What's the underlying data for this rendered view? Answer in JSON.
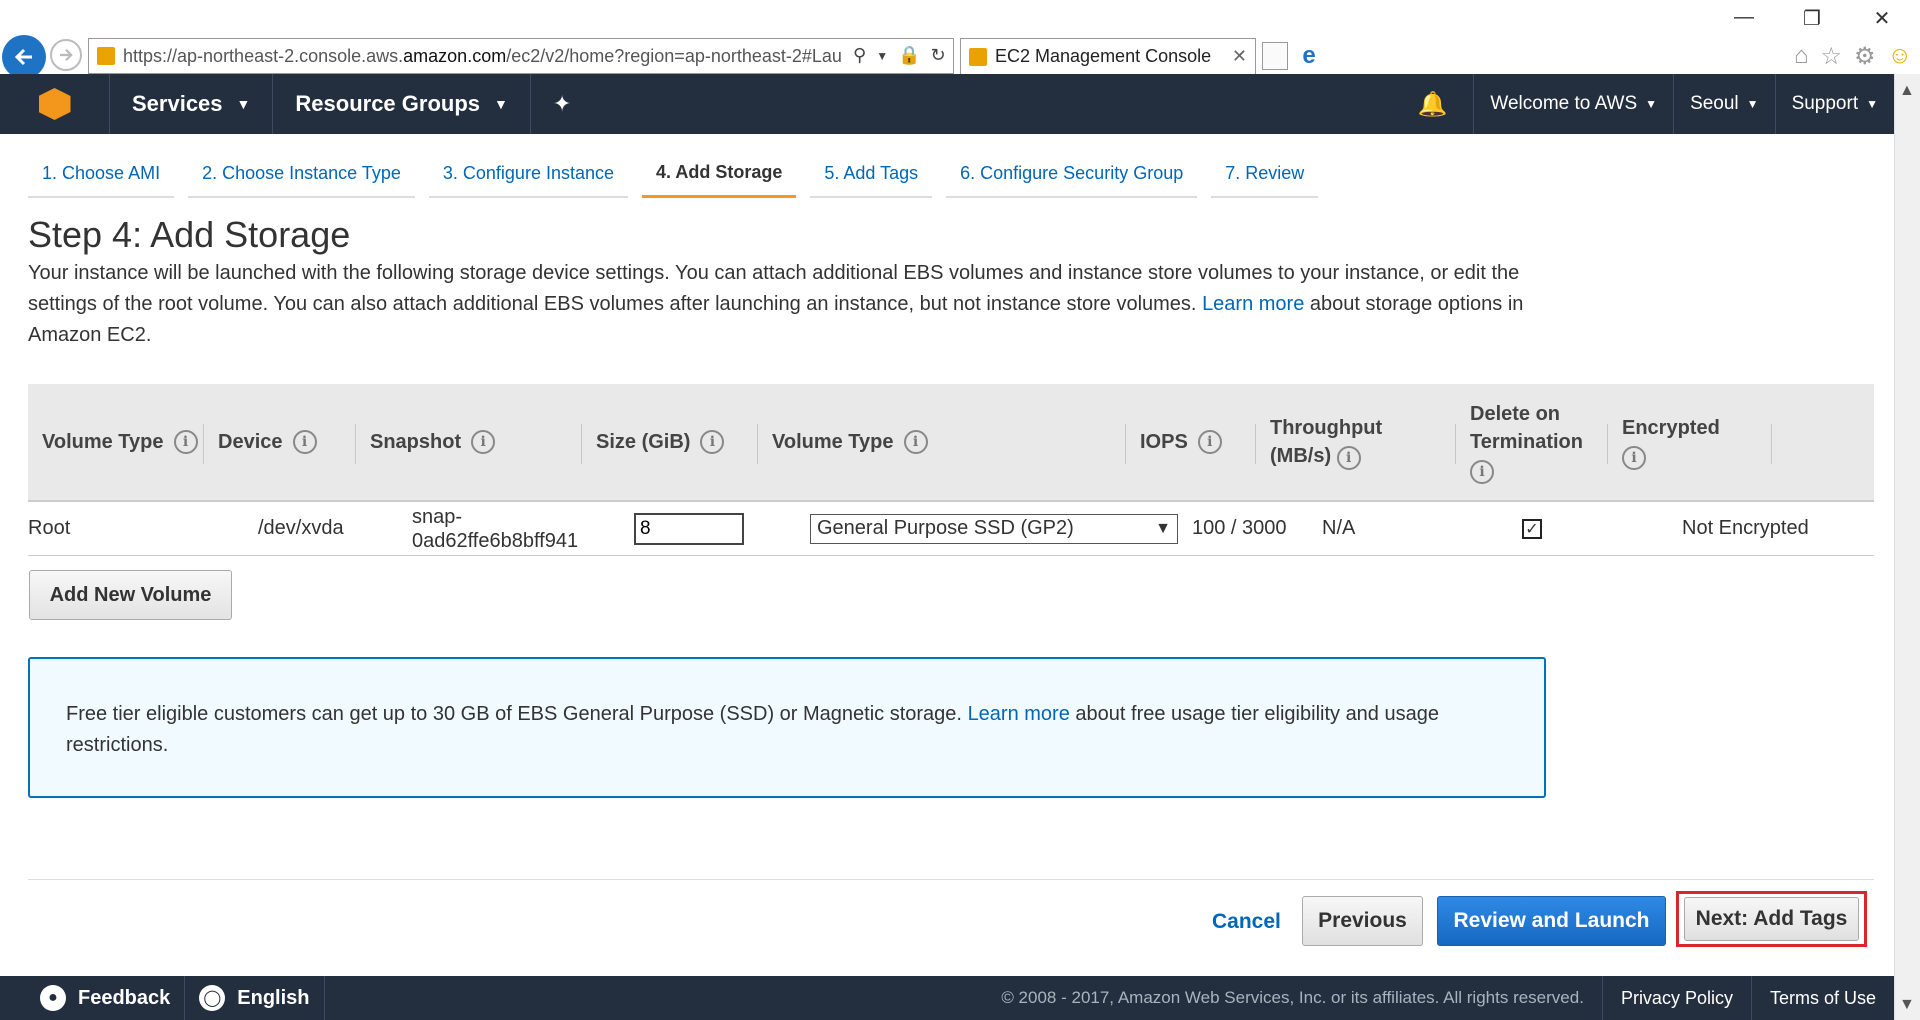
{
  "browser": {
    "url_prefix": "https://ap-northeast-2.console.aws.",
    "url_domain": "amazon.com",
    "url_suffix": "/ec2/v2/home?region=ap-northeast-2#Lau",
    "tab_title": "EC2 Management Console"
  },
  "topnav": {
    "services": "Services",
    "resource_groups": "Resource Groups",
    "welcome": "Welcome to AWS",
    "region": "Seoul",
    "support": "Support"
  },
  "steps": [
    {
      "label": "1. Choose AMI"
    },
    {
      "label": "2. Choose Instance Type"
    },
    {
      "label": "3. Configure Instance"
    },
    {
      "label": "4. Add Storage"
    },
    {
      "label": "5. Add Tags"
    },
    {
      "label": "6. Configure Security Group"
    },
    {
      "label": "7. Review"
    }
  ],
  "page": {
    "title": "Step 4: Add Storage",
    "intro_before": "Your instance will be launched with the following storage device settings. You can attach additional EBS volumes and instance store volumes to your instance, or edit the settings of the root volume. You can also attach additional EBS volumes after launching an instance, but not instance store volumes.",
    "intro_link": "Learn more",
    "intro_after": "about storage options in Amazon EC2."
  },
  "table": {
    "headers": {
      "volume_type": "Volume Type",
      "device": "Device",
      "snapshot": "Snapshot",
      "size": "Size (GiB)",
      "vol_type2": "Volume Type",
      "iops": "IOPS",
      "throughput_1": "Throughput",
      "throughput_2": "(MB/s)",
      "delete_1": "Delete on",
      "delete_2": "Termination",
      "encrypted": "Encrypted"
    },
    "row": {
      "volume_type": "Root",
      "device": "/dev/xvda",
      "snapshot_1": "snap-",
      "snapshot_2": "0ad62ffe6b8bff941",
      "size": "8",
      "vol_type": "General Purpose SSD (GP2)",
      "iops": "100 / 3000",
      "throughput": "N/A",
      "delete_on_termination": true,
      "encrypted": "Not Encrypted"
    }
  },
  "add_volume": "Add New Volume",
  "notice": {
    "before": "Free tier eligible customers can get up to 30 GB of EBS General Purpose (SSD) or Magnetic storage.",
    "link": "Learn more",
    "after": "about free usage tier eligibility and usage restrictions."
  },
  "buttons": {
    "cancel": "Cancel",
    "previous": "Previous",
    "review": "Review and Launch",
    "next": "Next: Add Tags"
  },
  "footer": {
    "feedback": "Feedback",
    "language": "English",
    "copyright": "© 2008 - 2017, Amazon Web Services, Inc. or its affiliates. All rights reserved.",
    "privacy": "Privacy Policy",
    "terms": "Terms of Use"
  },
  "colors": {
    "nav_bg": "#232f3e",
    "link": "#0066b8",
    "active_step": "#f7971e",
    "primary_button": "#1668c2",
    "highlight": "#d9262c"
  }
}
